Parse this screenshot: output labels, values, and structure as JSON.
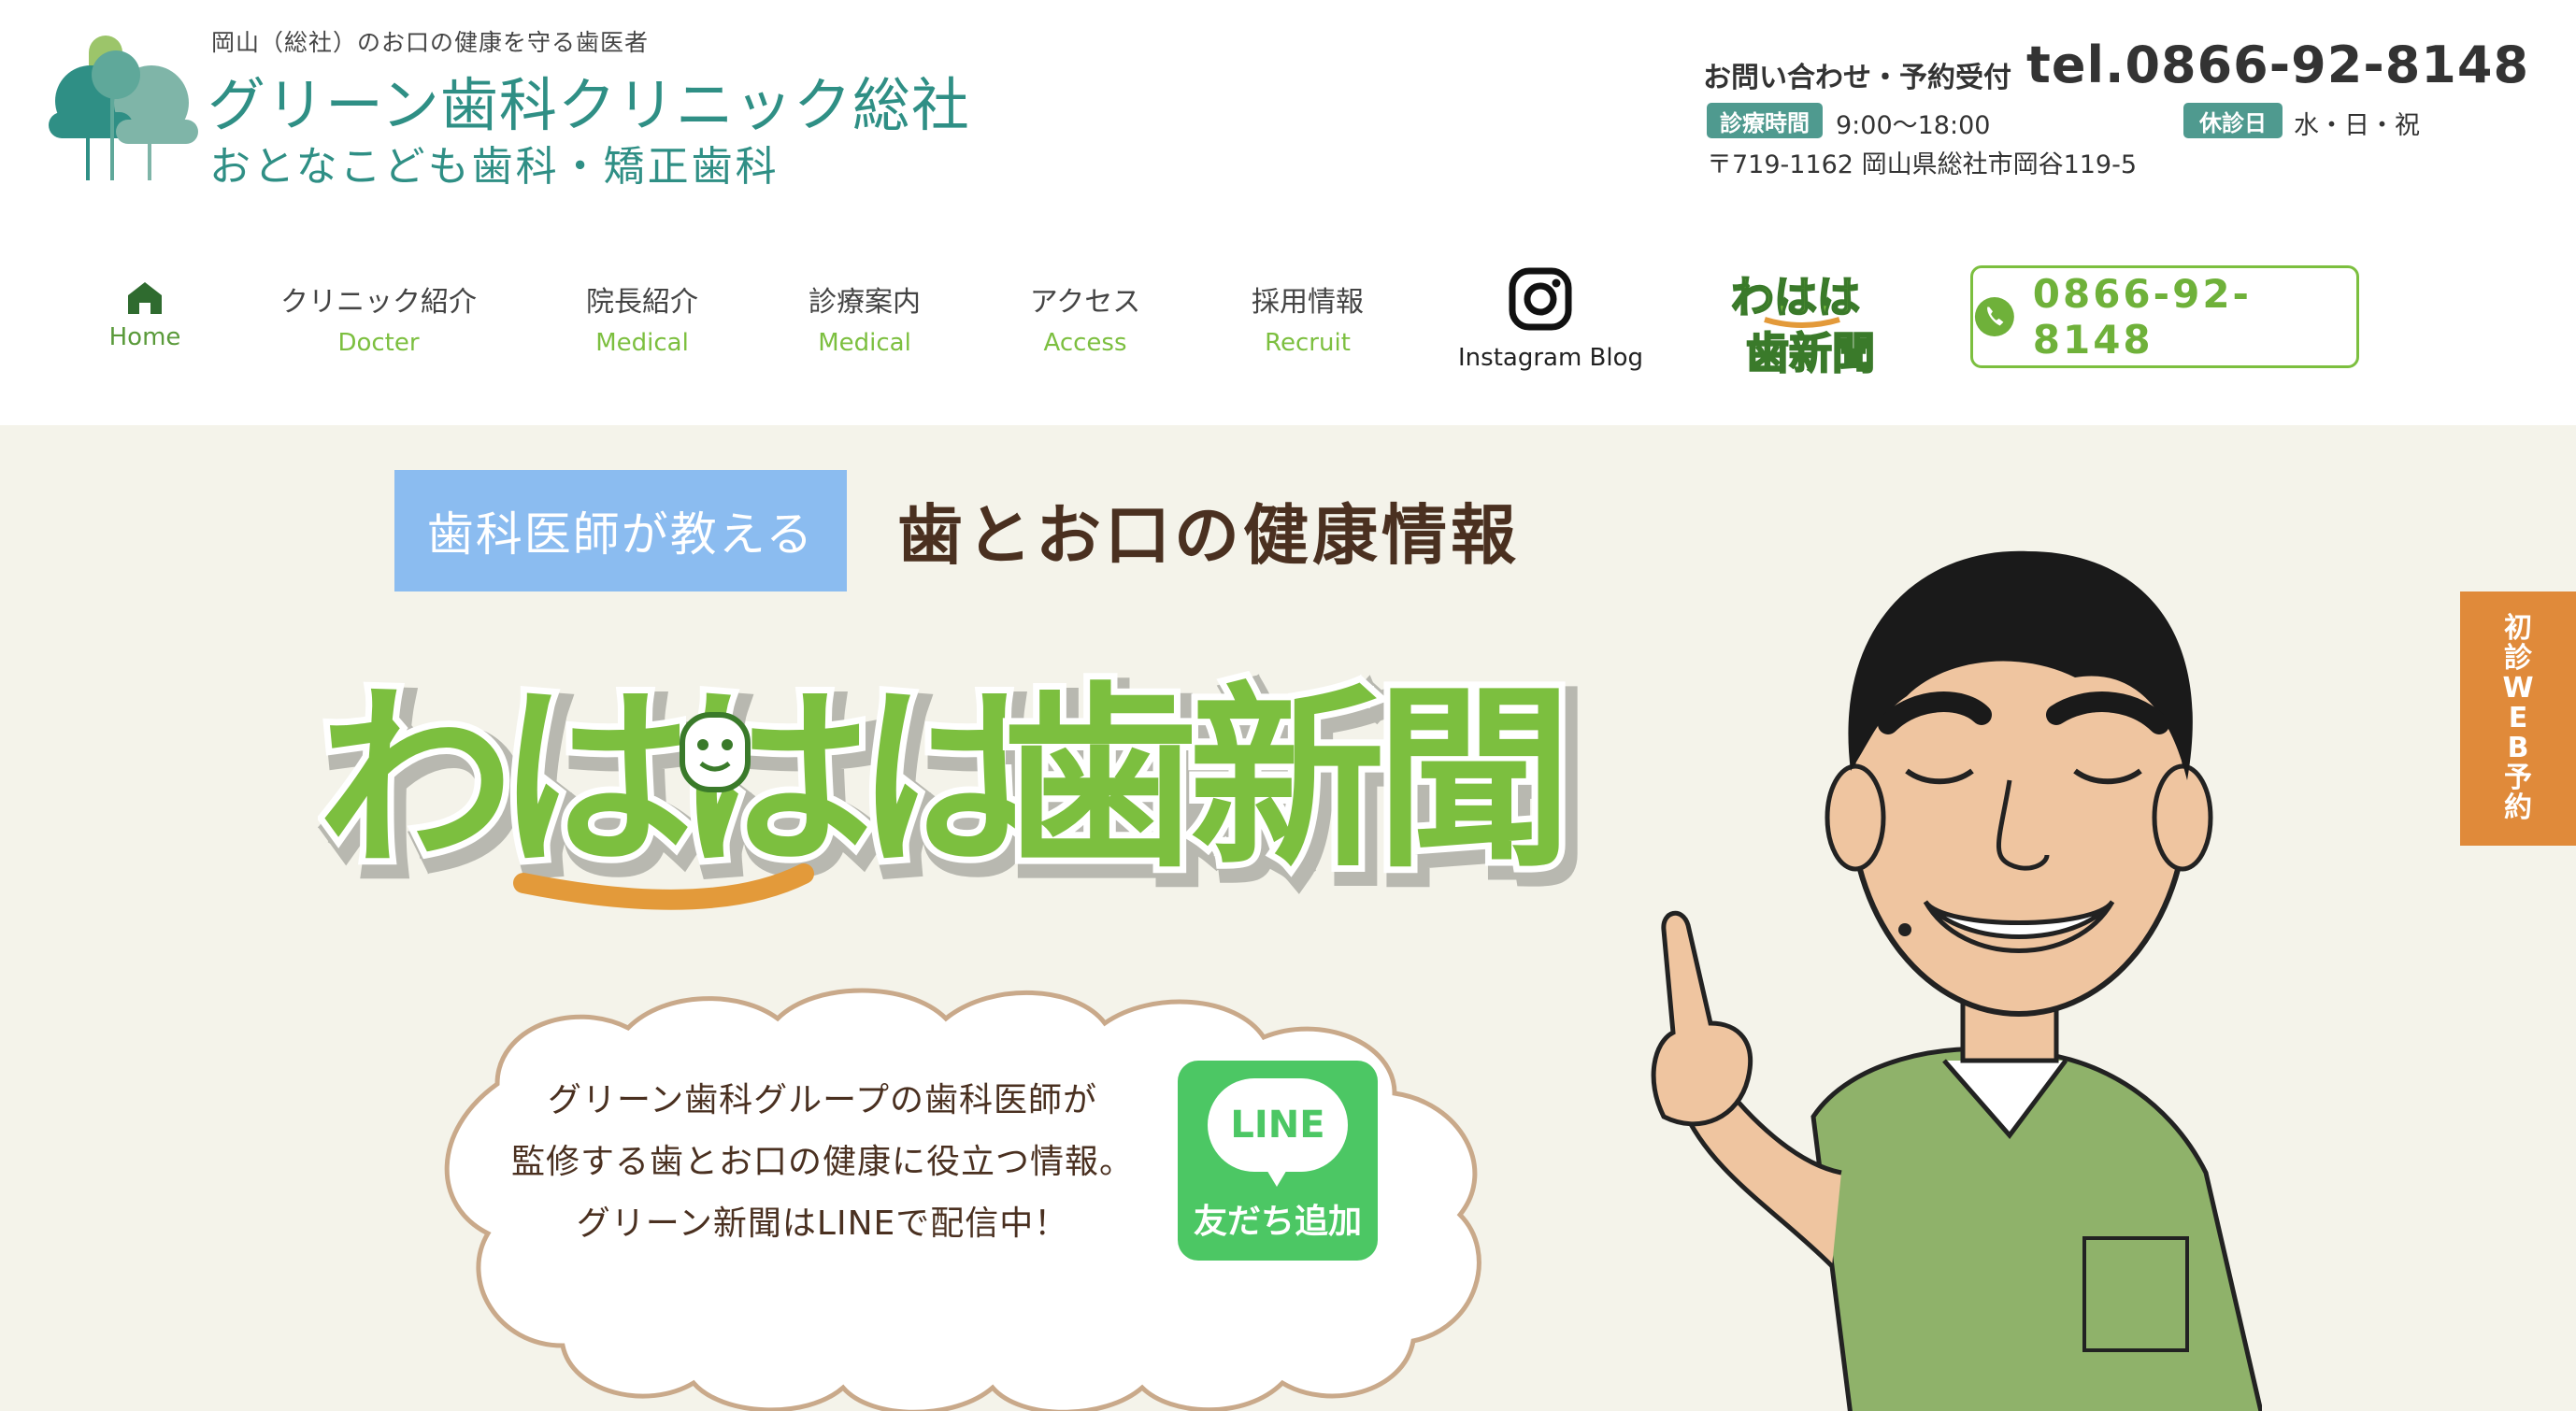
{
  "header": {
    "tagline": "岡山（総社）のお口の健康を守る歯医者",
    "clinic_name": "グリーン歯科クリニック総社",
    "clinic_sub": "おとなこども歯科・矯正歯科",
    "contact_label": "お問い合わせ・予約受付",
    "contact_tel": "tel.0866-92-8148",
    "hours_label": "診療時間",
    "hours_value": "9:00〜18:00",
    "closed_label": "休診日",
    "closed_value": "水・日・祝",
    "address": "〒719-1162 岡山県総社市岡谷119-5"
  },
  "nav": {
    "home": "Home",
    "items": [
      {
        "jp": "クリニック紹介",
        "en": "Docter"
      },
      {
        "jp": "院長紹介",
        "en": "Medical"
      },
      {
        "jp": "診療案内",
        "en": "Medical"
      },
      {
        "jp": "アクセス",
        "en": "Access"
      },
      {
        "jp": "採用情報",
        "en": "Recruit"
      }
    ],
    "instagram_label": "Instagram Blog",
    "tel_button": "0866-92-8148"
  },
  "hero": {
    "label": "歯科医師が教える",
    "title": "歯とお口の健康情報",
    "logo_text": "わははは歯新聞",
    "cloud_lines": [
      "グリーン歯科グループの歯科医師が",
      "監修する歯とお口の健康に役立つ情報。",
      "グリーン新聞はLINEで配信中！"
    ],
    "line_logo": "LINE",
    "line_button": "友だち追加"
  },
  "side_tab": {
    "chars": [
      "初",
      "診",
      "W",
      "E",
      "B",
      "予",
      "約"
    ]
  },
  "colors": {
    "brand_teal": "#2f8f85",
    "nav_green": "#7cbf3f",
    "hero_bg": "#f4f3ea",
    "label_blue": "#8bbcf0",
    "line_green": "#4cc764",
    "web_orange": "#e08a3a"
  },
  "icons": [
    "home-icon",
    "instagram-icon",
    "phone-icon",
    "tree-logo-icon"
  ]
}
